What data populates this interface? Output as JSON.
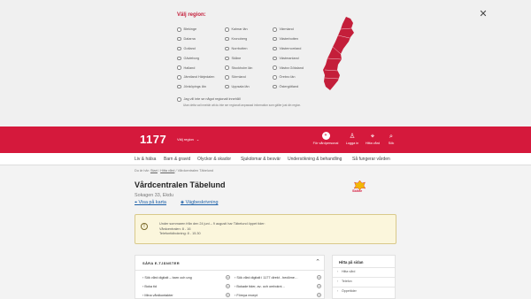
{
  "region_panel": {
    "title": "Välj region:",
    "columns": [
      [
        "Blekinge",
        "Dalarna",
        "Gotland",
        "Gävleborg",
        "Halland",
        "Jämtland Härjedalen",
        "Jönköpings län"
      ],
      [
        "Kalmar län",
        "Kronoberg",
        "Norrbotten",
        "Skåne",
        "Stockholm län",
        "Sörmland",
        "Uppsala län"
      ],
      [
        "Värmland",
        "Västerbotten",
        "Västernorrland",
        "Västmanland",
        "Västra Götaland",
        "Örebro län",
        "Östergötland"
      ]
    ],
    "no_region_label": "Jag vill inte se något regionalt innehåll",
    "note": "Utan detta val innebär att du inte ser regionalt anpassad information som gäller just din region.",
    "map_color": "#c41e3a",
    "close_icon": "close-icon"
  },
  "header": {
    "logo": "1177",
    "region_select": "Välj region",
    "icons": [
      {
        "label": "För vårdpersonal",
        "glyph": "+",
        "icon": "plus-circle-icon"
      },
      {
        "label": "Logga in",
        "glyph": "♙",
        "icon": "person-icon"
      },
      {
        "label": "Hitta vård",
        "glyph": "⌖",
        "icon": "location-pin-icon"
      },
      {
        "label": "Sök",
        "glyph": "⌕",
        "icon": "search-icon"
      }
    ],
    "brand_color": "#d5193c"
  },
  "nav": [
    "Liv & hälsa",
    "Barn & gravid",
    "Olyckor & skador",
    "Sjukdomar & besvär",
    "Undersökning & behandling",
    "Så fungerar vården"
  ],
  "breadcrumb": {
    "prefix": "Du är här:",
    "items": [
      "Start",
      "Hitta vård"
    ],
    "current": "Vårdcentralen Täbelund"
  },
  "page": {
    "title": "Vårdcentralen Täbelund",
    "address": "Sokagen 33, Ekdu",
    "link_map": "Visa på karta",
    "link_directions": "Vägbeskrivning",
    "brand": "Skåne"
  },
  "notice": {
    "icon": "info-icon",
    "lines": [
      "Under sommaren från den 24 juni – 9 augusti har Täbelund öppet tider:",
      "Vårdcentralen: 8 - 16",
      "Telefontidbokning: 8 - 15.30"
    ]
  },
  "services": {
    "title": "SÅRA E-TJÄNSTER",
    "col1": [
      "Sök vård digitalt – barn och ung",
      "Boka tid",
      "Mina vårdkontakter"
    ],
    "col2": [
      "Sök vård digitalt i 1177 direkt - bedöme…",
      "Bokade tider, av- och ombokni…",
      "Förnya recept"
    ]
  },
  "sidebar": {
    "title": "Hitta på sidan",
    "items": [
      "Hitta vård",
      "Telefon",
      "Öppettider"
    ]
  }
}
